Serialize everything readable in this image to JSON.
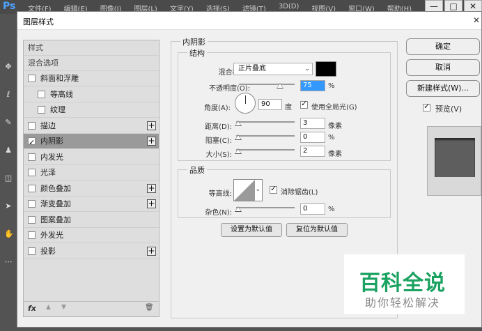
{
  "app": {
    "logo": "Ps",
    "menu": [
      "文件(F)",
      "编辑(E)",
      "图像(I)",
      "图层(L)",
      "文字(Y)",
      "选择(S)",
      "滤镜(T)",
      "3D(D)",
      "视图(V)",
      "窗口(W)",
      "帮助(H)"
    ],
    "win_min": "—",
    "win_max": "□",
    "win_close": "✕"
  },
  "dialog": {
    "title": "图层样式",
    "close": "✕"
  },
  "sidebar": {
    "header_styles": "样式",
    "header_blend": "混合选项",
    "items": [
      {
        "label": "斜面和浮雕",
        "checked": false,
        "plus": false,
        "indent": 0
      },
      {
        "label": "等高线",
        "checked": false,
        "plus": false,
        "indent": 1
      },
      {
        "label": "纹理",
        "checked": false,
        "plus": false,
        "indent": 1
      },
      {
        "label": "描边",
        "checked": false,
        "plus": true,
        "indent": 0
      },
      {
        "label": "内阴影",
        "checked": true,
        "plus": true,
        "indent": 0,
        "active": true
      },
      {
        "label": "内发光",
        "checked": false,
        "plus": false,
        "indent": 0
      },
      {
        "label": "光泽",
        "checked": false,
        "plus": false,
        "indent": 0
      },
      {
        "label": "颜色叠加",
        "checked": false,
        "plus": true,
        "indent": 0
      },
      {
        "label": "渐变叠加",
        "checked": false,
        "plus": true,
        "indent": 0
      },
      {
        "label": "图案叠加",
        "checked": false,
        "plus": false,
        "indent": 0
      },
      {
        "label": "外发光",
        "checked": false,
        "plus": false,
        "indent": 0
      },
      {
        "label": "投影",
        "checked": false,
        "plus": true,
        "indent": 0
      }
    ],
    "foot_fx": "fx",
    "foot_up": "▲",
    "foot_down": "▼",
    "foot_trash": "🗑"
  },
  "inner_shadow": {
    "section_title": "内阴影",
    "structure_title": "结构",
    "blend_mode_label": "混合模式:",
    "blend_mode_value": "正片叠底",
    "color": "#000000",
    "opacity_label": "不透明度(O):",
    "opacity_value": "75",
    "opacity_unit": "%",
    "angle_label": "角度(A):",
    "angle_value": "90",
    "angle_unit": "度",
    "global_light_label": "使用全局光(G)",
    "distance_label": "距离(D):",
    "distance_value": "3",
    "distance_unit": "像素",
    "choke_label": "阻塞(C):",
    "choke_value": "0",
    "choke_unit": "%",
    "size_label": "大小(S):",
    "size_value": "2",
    "size_unit": "像素",
    "quality_title": "品质",
    "contour_label": "等高线:",
    "antialias_label": "消除锯齿(L)",
    "noise_label": "杂色(N):",
    "noise_value": "0",
    "noise_unit": "%",
    "default_set": "设置为默认值",
    "default_reset": "复位为默认值"
  },
  "actions": {
    "ok": "确定",
    "cancel": "取消",
    "new_style": "新建样式(W)...",
    "preview_label": "预览(V)"
  },
  "watermark": {
    "big": "百科全说",
    "small": "助你轻松解决"
  }
}
